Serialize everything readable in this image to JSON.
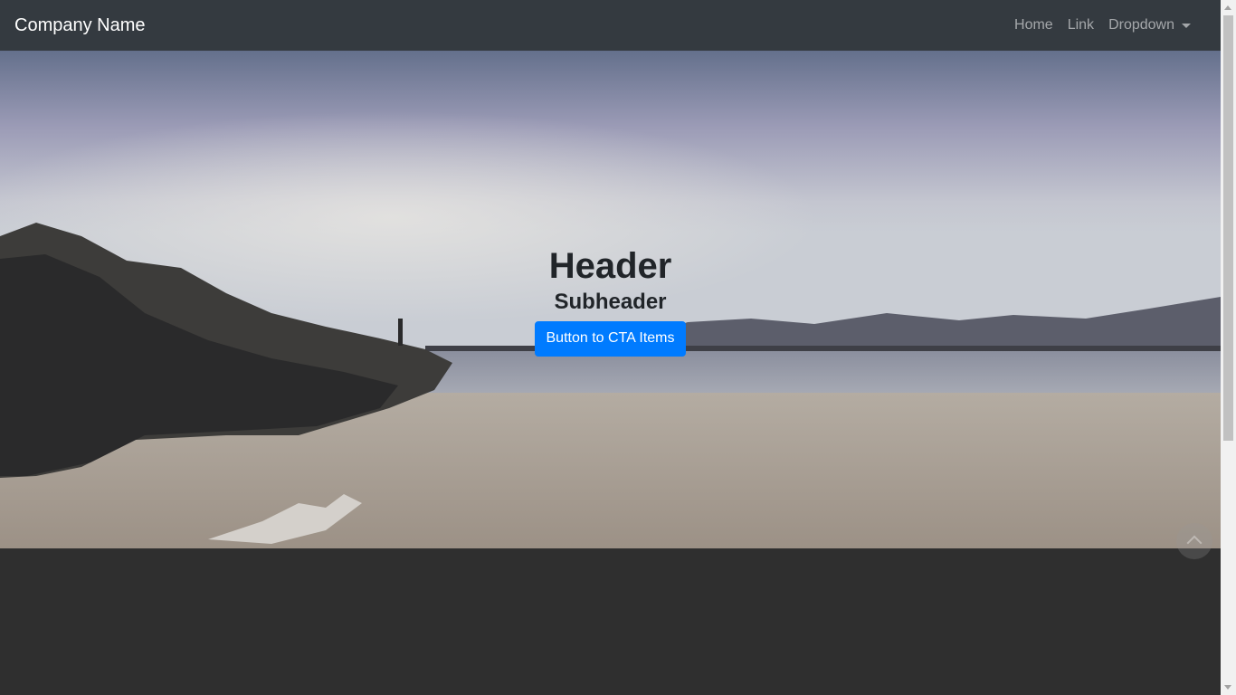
{
  "navbar": {
    "brand": "Company Name",
    "links": [
      {
        "label": "Home"
      },
      {
        "label": "Link"
      },
      {
        "label": "Dropdown"
      }
    ]
  },
  "hero": {
    "title": "Header",
    "subtitle": "Subheader",
    "cta_label": "Button to CTA Items",
    "background_description_icon": "beach-photo"
  },
  "colors": {
    "navbar_bg": "#343a40",
    "page_bg": "#2f2f2f",
    "cta_bg": "#007bff",
    "text_dark": "#212529"
  },
  "icons": {
    "dropdown_caret": "caret-down-icon",
    "scroll_top": "chevron-up-icon"
  }
}
